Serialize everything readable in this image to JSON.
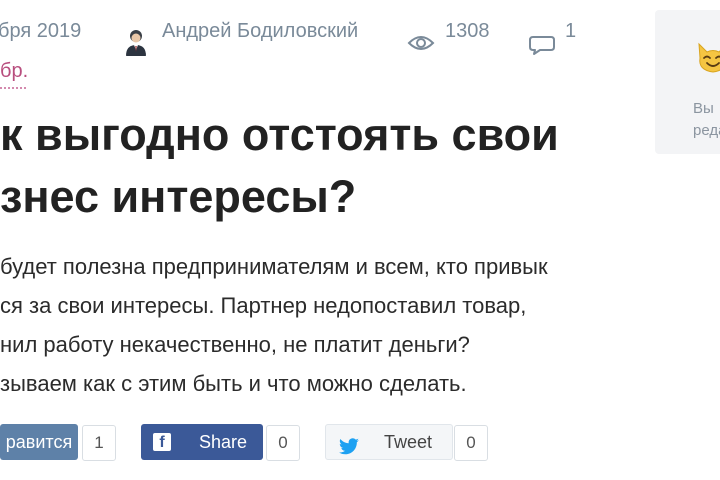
{
  "meta": {
    "date": "бря 2019",
    "author": "Андрей Бодиловский",
    "views": "1308",
    "comments": "1"
  },
  "tag": "бр.",
  "article": {
    "title_lines": [
      "к выгодно отстоять свои",
      "знес интересы?"
    ],
    "lead_lines": [
      "будет полезна предпринимателям и всем, кто привык",
      "ся за свои интересы. Партнер недопоставил товар,",
      "нил работу некачественно, не платит деньги?",
      "зываем как с этим быть и что можно сделать."
    ]
  },
  "share": {
    "vk_label": "равится",
    "vk_count": "1",
    "fb_label": "Share",
    "fb_count": "0",
    "tw_label": "Tweet",
    "tw_count": "0"
  },
  "widget": {
    "lines": [
      "Вы",
      "реда"
    ]
  },
  "icons": {
    "views": "eye-icon",
    "comments": "speech-bubble-icon",
    "facebook": "facebook-icon",
    "twitter": "twitter-bird-icon",
    "widget": "cat-face-icon"
  },
  "colors": {
    "meta_text": "#7a8a99",
    "tag": "#b84e7e",
    "vk_button": "#5e81a8",
    "fb_button": "#3b5998",
    "tw_bird": "#1da1f2",
    "widget_bg": "#f3f4f6",
    "cat": "#f5c542"
  }
}
